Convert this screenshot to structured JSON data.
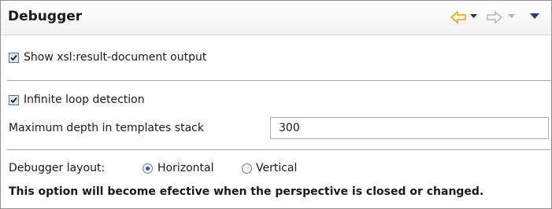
{
  "header": {
    "title": "Debugger",
    "icons": [
      "back-arrow-icon",
      "back-dropdown-icon",
      "forward-arrow-icon",
      "forward-dropdown-icon",
      "view-menu-icon"
    ]
  },
  "options": {
    "show_result_document": {
      "label": "Show xsl:result-document output",
      "checked": true
    },
    "infinite_loop": {
      "label": "Infinite loop detection",
      "checked": true
    },
    "max_depth": {
      "label": "Maximum depth in templates stack",
      "value": "300"
    }
  },
  "layout": {
    "label": "Debugger layout:",
    "options": [
      {
        "label": "Horizontal",
        "selected": true
      },
      {
        "label": "Vertical",
        "selected": false
      }
    ]
  },
  "note": "This option will become efective when the perspective is closed or changed.",
  "colors": {
    "back_arrow": "#e8a317",
    "forward_arrow": "#b8b8b8",
    "checkbox_border": "#3c7fb1",
    "radio_selected": "#1f5fa8"
  }
}
